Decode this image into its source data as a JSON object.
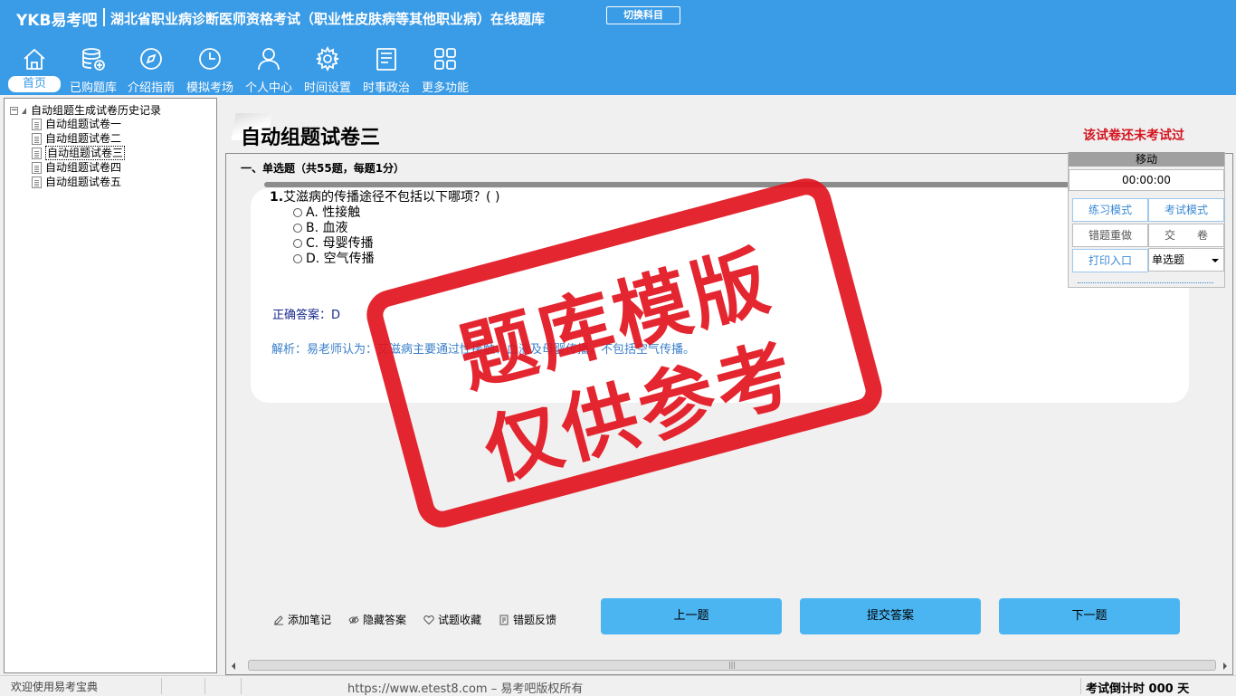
{
  "header": {
    "logo": "YKB易考吧",
    "title": "湖北省职业病诊断医师资格考试（职业性皮肤病等其他职业病）在线题库",
    "switch_label": "切换科目"
  },
  "nav": [
    {
      "label": "首页",
      "icon": "home-icon"
    },
    {
      "label": "已购题库",
      "icon": "database-icon"
    },
    {
      "label": "介绍指南",
      "icon": "compass-icon"
    },
    {
      "label": "模拟考场",
      "icon": "clock-icon"
    },
    {
      "label": "个人中心",
      "icon": "user-icon"
    },
    {
      "label": "时间设置",
      "icon": "gear-icon"
    },
    {
      "label": "时事政治",
      "icon": "news-icon"
    },
    {
      "label": "更多功能",
      "icon": "grid-icon"
    }
  ],
  "tree": {
    "root": "自动组题生成试卷历史记录",
    "items": [
      "自动组题试卷一",
      "自动组题试卷二",
      "自动组题试卷三",
      "自动组题试卷四",
      "自动组题试卷五"
    ],
    "selected_index": 2
  },
  "paper": {
    "title": "自动组题试卷三",
    "status": "该试卷还未考试过",
    "section": "一、单选题（共55题，每题1分）"
  },
  "question": {
    "number": "1.",
    "text": "艾滋病的传播途径不包括以下哪项？( )",
    "options": [
      "A. 性接触",
      "B. 血液",
      "C. 母婴传播",
      "D. 空气传播"
    ],
    "answer": "正确答案：D",
    "analysis": "解析：易老师认为：艾滋病主要通过性接触、血液及母婴传播，不包括空气传播。"
  },
  "side_panel": {
    "move": "移动",
    "timer": "00:00:00",
    "practice_mode": "练习模式",
    "exam_mode": "考试模式",
    "redo_wrong": "错题重做",
    "submit_paper": "交　　卷",
    "print": "打印入口",
    "type_select": "单选题"
  },
  "tools": {
    "add_note": "添加笔记",
    "hide_answer": "隐藏答案",
    "favorite": "试题收藏",
    "feedback": "错题反馈",
    "prev": "上一题",
    "submit": "提交答案",
    "next": "下一题"
  },
  "stamp": {
    "line1": "题库模版",
    "line2": "仅供参考"
  },
  "statusbar": {
    "welcome": "欢迎使用易考宝典",
    "url": "https://www.etest8.com – 易考吧版权所有",
    "countdown": "考试倒计时 000 天"
  },
  "colors": {
    "header_bg": "#3a9be6",
    "button_bg": "#4bb5f2",
    "stamp": "#e2141e",
    "status_red": "#d4141e"
  }
}
